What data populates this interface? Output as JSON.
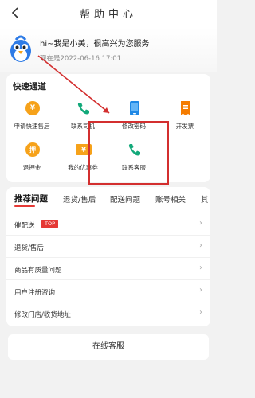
{
  "header": {
    "title": "帮助中心",
    "back_icon": "chevron-left-icon"
  },
  "greeting": {
    "message": "hi~我是小美，很高兴为您服务!",
    "timestamp": "现在是2022-06-16 17:01",
    "avatar_icon": "bird-mascot-icon"
  },
  "quick_access": {
    "title": "快速通道",
    "items": [
      {
        "label": "申请快速售后",
        "icon": "after-sale-coin-icon",
        "glyph": "¥"
      },
      {
        "label": "联系司机",
        "icon": "phone-icon"
      },
      {
        "label": "修改密码",
        "icon": "mobile-phone-icon"
      },
      {
        "label": "开发票",
        "icon": "invoice-icon"
      },
      {
        "label": "退押金",
        "icon": "deposit-refund-icon",
        "glyph": "押"
      },
      {
        "label": "我的优惠券",
        "icon": "coupon-icon",
        "glyph": "¥"
      },
      {
        "label": "联系客服",
        "icon": "phone-icon"
      }
    ]
  },
  "faq": {
    "tabs": [
      "推荐问题",
      "退货/售后",
      "配送问题",
      "账号相关",
      "其"
    ],
    "active_tab": 0,
    "rows": [
      {
        "label": "催配送",
        "badge": "TOP"
      },
      {
        "label": "退货/售后"
      },
      {
        "label": "商品有质量问题"
      },
      {
        "label": "用户注册咨询"
      },
      {
        "label": "修改门店/收货地址"
      }
    ]
  },
  "footer": {
    "service_button": "在线客服"
  },
  "colors": {
    "accent": "#e53935",
    "phone_green": "#13a97a",
    "orange": "#f6a21a",
    "blue": "#1e88e5"
  }
}
